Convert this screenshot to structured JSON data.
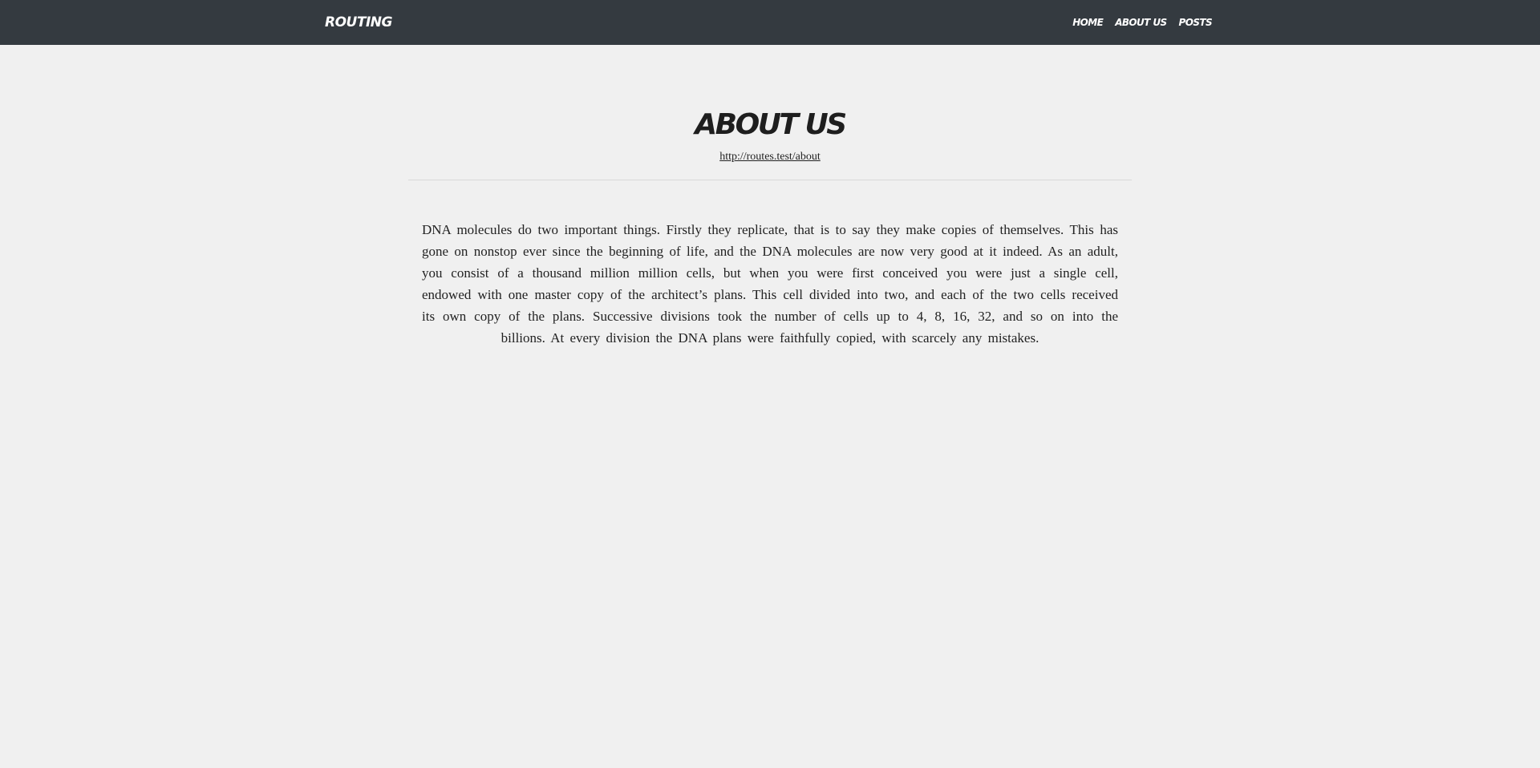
{
  "navbar": {
    "brand": "ROUTING",
    "links": [
      {
        "label": "HOME"
      },
      {
        "label": "ABOUT US"
      },
      {
        "label": "POSTS"
      }
    ]
  },
  "page": {
    "title": "ABOUT US",
    "url": "http://routes.test/about",
    "body": "DNA molecules do two important things. Firstly they replicate, that is to say they make copies of themselves. This has gone on nonstop ever since the beginning of life, and the DNA molecules are now very good at it indeed. As an adult, you consist of a thousand million million cells, but when you were first conceived you were just a single cell, endowed with one master copy of the architect’s plans. This cell divided into two, and each of the two cells received its own copy of the plans. Successive divisions took the number of cells up to 4, 8, 16, 32, and so on into the billions. At every division the DNA plans were faithfully copied, with scarcely any mistakes."
  },
  "colors": {
    "navbar_bg": "#343a40",
    "page_bg": "#f0f0f0",
    "text": "#222222"
  }
}
